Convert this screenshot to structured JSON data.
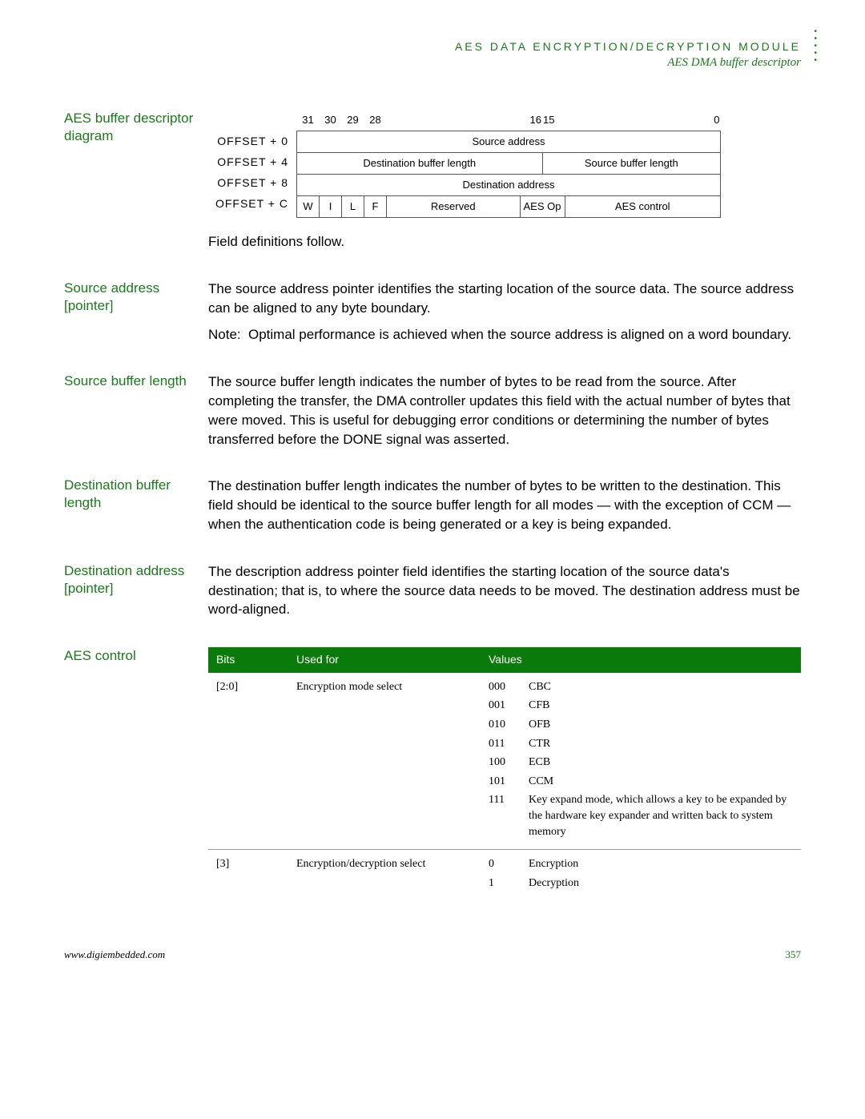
{
  "header": {
    "line1": "AES DATA ENCRYPTION/DECRYPTION MODULE",
    "line2": "AES DMA buffer descriptor"
  },
  "diagram": {
    "title": "AES buffer descriptor diagram",
    "offsets": [
      "OFFSET + 0",
      "OFFSET + 4",
      "OFFSET + 8",
      "OFFSET + C"
    ],
    "bits": {
      "b31": "31",
      "b30": "30",
      "b29": "29",
      "b28": "28",
      "b16": "16",
      "b15": "15",
      "b0": "0"
    },
    "row0": {
      "c0": "Source address"
    },
    "row1": {
      "c0": "Destination buffer length",
      "c1": "Source buffer length"
    },
    "row2": {
      "c0": "Destination address"
    },
    "row3": {
      "w": "W",
      "i": "I",
      "l": "L",
      "f": "F",
      "res": "Reserved",
      "op": "AES Op",
      "ctrl": "AES control"
    },
    "follow": "Field definitions follow."
  },
  "sections": {
    "src_addr": {
      "title": "Source address [pointer]",
      "body": "The source address pointer identifies the starting location of the source data. The source address can be aligned to any byte boundary.",
      "note_lbl": "Note:",
      "note": "Optimal performance is achieved when the source address is aligned on a word boundary."
    },
    "src_len": {
      "title": "Source buffer length",
      "body": "The source buffer length indicates the number of bytes to be read from the source. After completing the transfer, the DMA controller updates this field with the actual number of bytes that were moved. This is useful for debugging error conditions or determining the number of bytes transferred before the DONE signal was asserted."
    },
    "dst_len": {
      "title": "Destination buffer length",
      "body": "The destination buffer length indicates the number of bytes to be written to the destination. This field should be identical to the source buffer length for all modes — with the exception of CCM — when the authentication code is being generated or a key is being expanded."
    },
    "dst_addr": {
      "title": "Destination address [pointer]",
      "body": "The description address pointer field identifies the starting location of the source data's destination; that is, to where the source data needs to be moved. The destination address must be word-aligned."
    },
    "aes_ctrl": {
      "title": "AES control"
    }
  },
  "aes_table": {
    "headers": {
      "bits": "Bits",
      "used": "Used for",
      "values": "Values"
    },
    "rows": [
      {
        "bits": "[2:0]",
        "used": "Encryption mode select",
        "values": [
          {
            "code": "000",
            "desc": "CBC"
          },
          {
            "code": "001",
            "desc": "CFB"
          },
          {
            "code": "010",
            "desc": "OFB"
          },
          {
            "code": "011",
            "desc": "CTR"
          },
          {
            "code": "100",
            "desc": "ECB"
          },
          {
            "code": "101",
            "desc": "CCM"
          },
          {
            "code": "111",
            "desc": "Key expand mode, which allows a key to be expanded by the hardware key expander and written back to system memory"
          }
        ]
      },
      {
        "bits": "[3]",
        "used": "Encryption/decryption select",
        "values": [
          {
            "code": "0",
            "desc": "Encryption"
          },
          {
            "code": "1",
            "desc": "Decryption"
          }
        ]
      }
    ]
  },
  "footer": {
    "url": "www.digiembedded.com",
    "page": "357"
  }
}
